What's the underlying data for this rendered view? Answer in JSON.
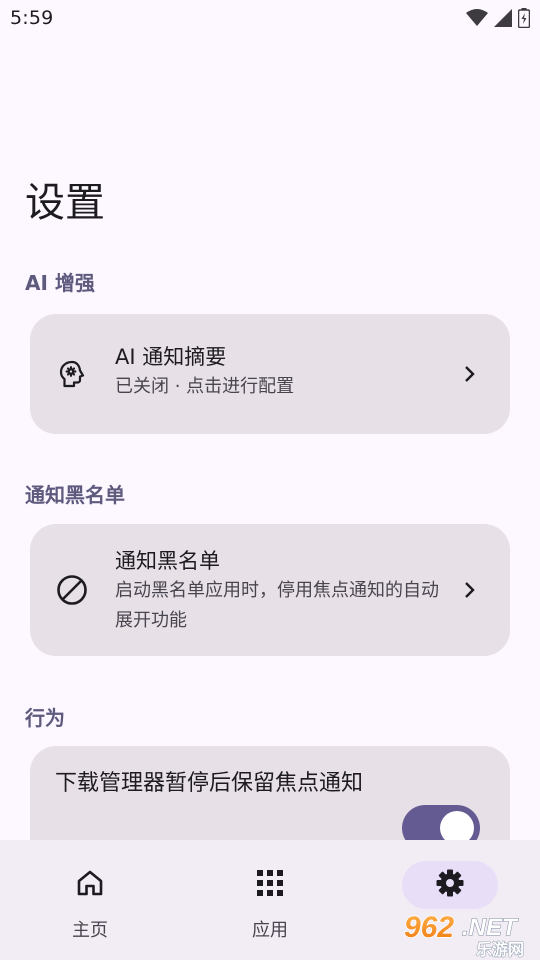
{
  "status_bar": {
    "time": "5:59",
    "icons": [
      "wifi-icon",
      "signal-icon",
      "battery-icon"
    ]
  },
  "page": {
    "title": "设置"
  },
  "sections": {
    "ai": {
      "header": "AI 增强",
      "card": {
        "icon": "ai-brain-icon",
        "title": "AI 通知摘要",
        "subtitle": "已关闭 · 点击进行配置"
      }
    },
    "blacklist": {
      "header": "通知黑名单",
      "card": {
        "icon": "block-icon",
        "title": "通知黑名单",
        "subtitle": "启动黑名单应用时，停用焦点通知的自动展开功能"
      }
    },
    "behavior": {
      "header": "行为",
      "toggle_card": {
        "label": "下载管理器暂停后保留焦点通知",
        "enabled": true
      }
    }
  },
  "bottom_nav": {
    "items": [
      {
        "label": "主页",
        "icon": "home-icon",
        "active": false
      },
      {
        "label": "应用",
        "icon": "apps-grid-icon",
        "active": false
      },
      {
        "label": "",
        "icon": "settings-gear-icon",
        "active": true
      }
    ]
  },
  "watermark": {
    "text": "962.NET",
    "subtext": "乐游网"
  },
  "colors": {
    "background": "#fdf7ff",
    "card": "#e7e0e7",
    "section_header": "#5e5a7e",
    "switch_on": "#655b93",
    "nav_background": "#f2ecf4",
    "nav_active_pill": "#e8def8"
  }
}
